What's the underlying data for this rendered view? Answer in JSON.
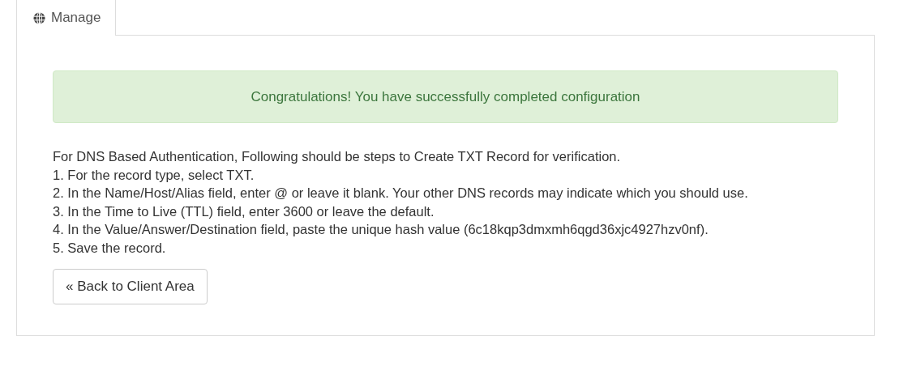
{
  "tabs": [
    {
      "label": "Manage",
      "selected": true
    }
  ],
  "alert": {
    "text": "Congratulations! You have successfully completed configuration"
  },
  "instructions": [
    "For DNS Based Authentication, Following should be steps to Create TXT Record for verification.",
    "1. For the record type, select TXT.",
    "2. In the Name/Host/Alias field, enter @ or leave it blank. Your other DNS records may indicate which you should use.",
    "3. In the Time to Live (TTL) field, enter 3600 or leave the default.",
    "4. In the Value/Answer/Destination field, paste the unique hash value (6c18kqp3dmxmh6qgd36xjc4927hzv0nf).",
    "5. Save the record."
  ],
  "buttons": [
    "« Back to Client Area"
  ]
}
